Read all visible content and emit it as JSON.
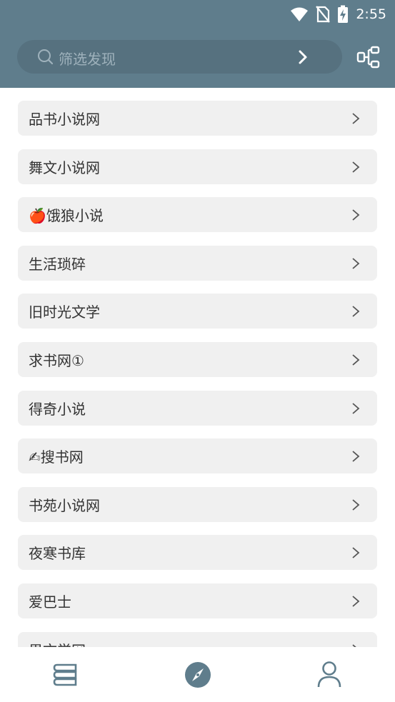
{
  "status": {
    "time": "2:55",
    "icons": [
      "wifi-icon",
      "no-sim-icon",
      "battery-charging-icon"
    ]
  },
  "search": {
    "placeholder": "筛选发现"
  },
  "header": {
    "right_icon": "structure-icon"
  },
  "sources": [
    {
      "label": "品书小说网"
    },
    {
      "label": "舞文小说网"
    },
    {
      "label": "🍎饿狼小说"
    },
    {
      "label": "生活琐碎"
    },
    {
      "label": "旧时光文学"
    },
    {
      "label": "求书网①"
    },
    {
      "label": "得奇小说"
    },
    {
      "label": "✍搜书网"
    },
    {
      "label": "书苑小说网"
    },
    {
      "label": "夜寒书库"
    },
    {
      "label": "爱巴士"
    },
    {
      "label": "男文学网"
    }
  ],
  "bottom_nav": [
    {
      "name": "bookshelf",
      "icon": "bookshelf-icon",
      "active": false
    },
    {
      "name": "discover",
      "icon": "compass-icon",
      "active": true
    },
    {
      "name": "profile",
      "icon": "user-icon",
      "active": false
    }
  ],
  "colors": {
    "header": "#5f7d8c",
    "search_bg": "#56717f",
    "item_bg": "#f0f0f0",
    "nav_icon": "#5f7d8c",
    "active_icon": "#5f7d8c"
  }
}
